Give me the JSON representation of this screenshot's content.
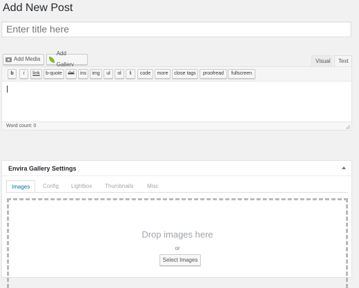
{
  "page": {
    "title": "Add New Post"
  },
  "post": {
    "title_placeholder": "Enter title here"
  },
  "media_buttons": {
    "add_media": "Add Media",
    "add_gallery": "Add Gallery"
  },
  "editor": {
    "tabs": {
      "visual": "Visual",
      "text": "Text"
    },
    "quicktags": [
      "b",
      "i",
      "link",
      "b-quote",
      "del",
      "ins",
      "img",
      "ul",
      "ol",
      "li",
      "code",
      "more",
      "close tags",
      "proofread",
      "fullscreen"
    ],
    "word_count": "Word count: 0"
  },
  "envira": {
    "title": "Envira Gallery Settings",
    "tabs": [
      "Images",
      "Config",
      "Lightbox",
      "Thumbnails",
      "Misc"
    ],
    "drop_title": "Drop images here",
    "drop_or": "or",
    "select_button": "Select Images"
  },
  "colors": {
    "accent": "#0073aa",
    "background": "#f1f1f1",
    "gallery_icon": "#7cbd2a"
  }
}
